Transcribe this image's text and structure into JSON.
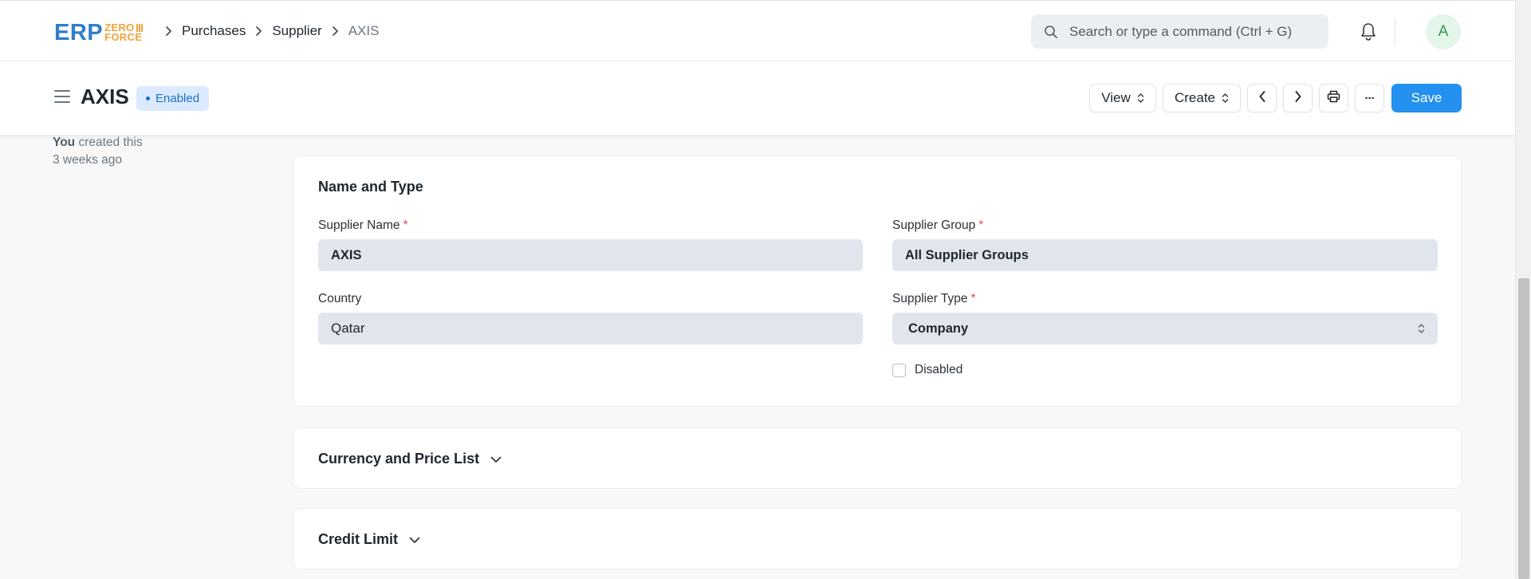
{
  "logo": {
    "erp": "ERP",
    "zero": "ZERO",
    "force": "FORCE"
  },
  "breadcrumb": {
    "items": [
      "Purchases",
      "Supplier"
    ],
    "current": "AXIS"
  },
  "search": {
    "placeholder": "Search or type a command (Ctrl + G)"
  },
  "user": {
    "avatar_letter": "A"
  },
  "doc": {
    "title": "AXIS",
    "status": "Enabled"
  },
  "toolbar": {
    "view_label": "View",
    "create_label": "Create",
    "save_label": "Save",
    "more_label": "···"
  },
  "timeline": {
    "actor": "You",
    "action": "created this",
    "when": "3 weeks ago"
  },
  "form": {
    "section_title": "Name and Type",
    "supplier_name": {
      "label": "Supplier Name",
      "required": "*",
      "value": "AXIS"
    },
    "supplier_group": {
      "label": "Supplier Group",
      "required": "*",
      "value": "All Supplier Groups"
    },
    "country": {
      "label": "Country",
      "value": "Qatar"
    },
    "supplier_type": {
      "label": "Supplier Type",
      "required": "*",
      "value": "Company"
    },
    "disabled": {
      "label": "Disabled",
      "checked": false
    }
  },
  "sections": {
    "currency": "Currency and Price List",
    "credit": "Credit Limit"
  },
  "colors": {
    "primary": "#2490ef",
    "badge_bg": "#dbeafe",
    "badge_text": "#1a6fc4",
    "field_bg": "#e1e6ee",
    "required": "#e24c4c"
  }
}
